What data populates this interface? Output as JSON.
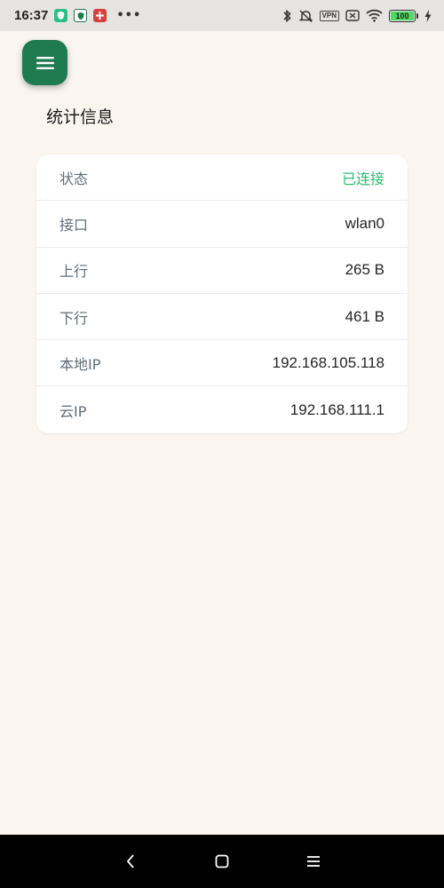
{
  "status_bar": {
    "time": "16:37",
    "more": "•••",
    "vpn_label": "VPN",
    "battery_level": "100",
    "icons": [
      "shield-app-icon",
      "shield-app-icon",
      "flower-app-icon",
      "bluetooth-icon",
      "mute-icon",
      "vpn-icon",
      "sim-off-icon",
      "wifi-icon",
      "battery-icon",
      "charging-icon"
    ]
  },
  "colors": {
    "accent": "#1e7a4f",
    "status_ok": "#2bbf6f",
    "background": "#faf5ef"
  },
  "page": {
    "title": "统计信息"
  },
  "stats": {
    "rows": [
      {
        "label": "状态",
        "value": "已连接"
      },
      {
        "label": "接口",
        "value": "wlan0"
      },
      {
        "label": "上行",
        "value": "265 B"
      },
      {
        "label": "下行",
        "value": "461 B"
      },
      {
        "label": "本地IP",
        "value": "192.168.105.118"
      },
      {
        "label": "云IP",
        "value": "192.168.111.1"
      }
    ]
  },
  "nav_bar": {
    "icons": [
      "back-icon",
      "home-icon",
      "recents-icon"
    ]
  }
}
